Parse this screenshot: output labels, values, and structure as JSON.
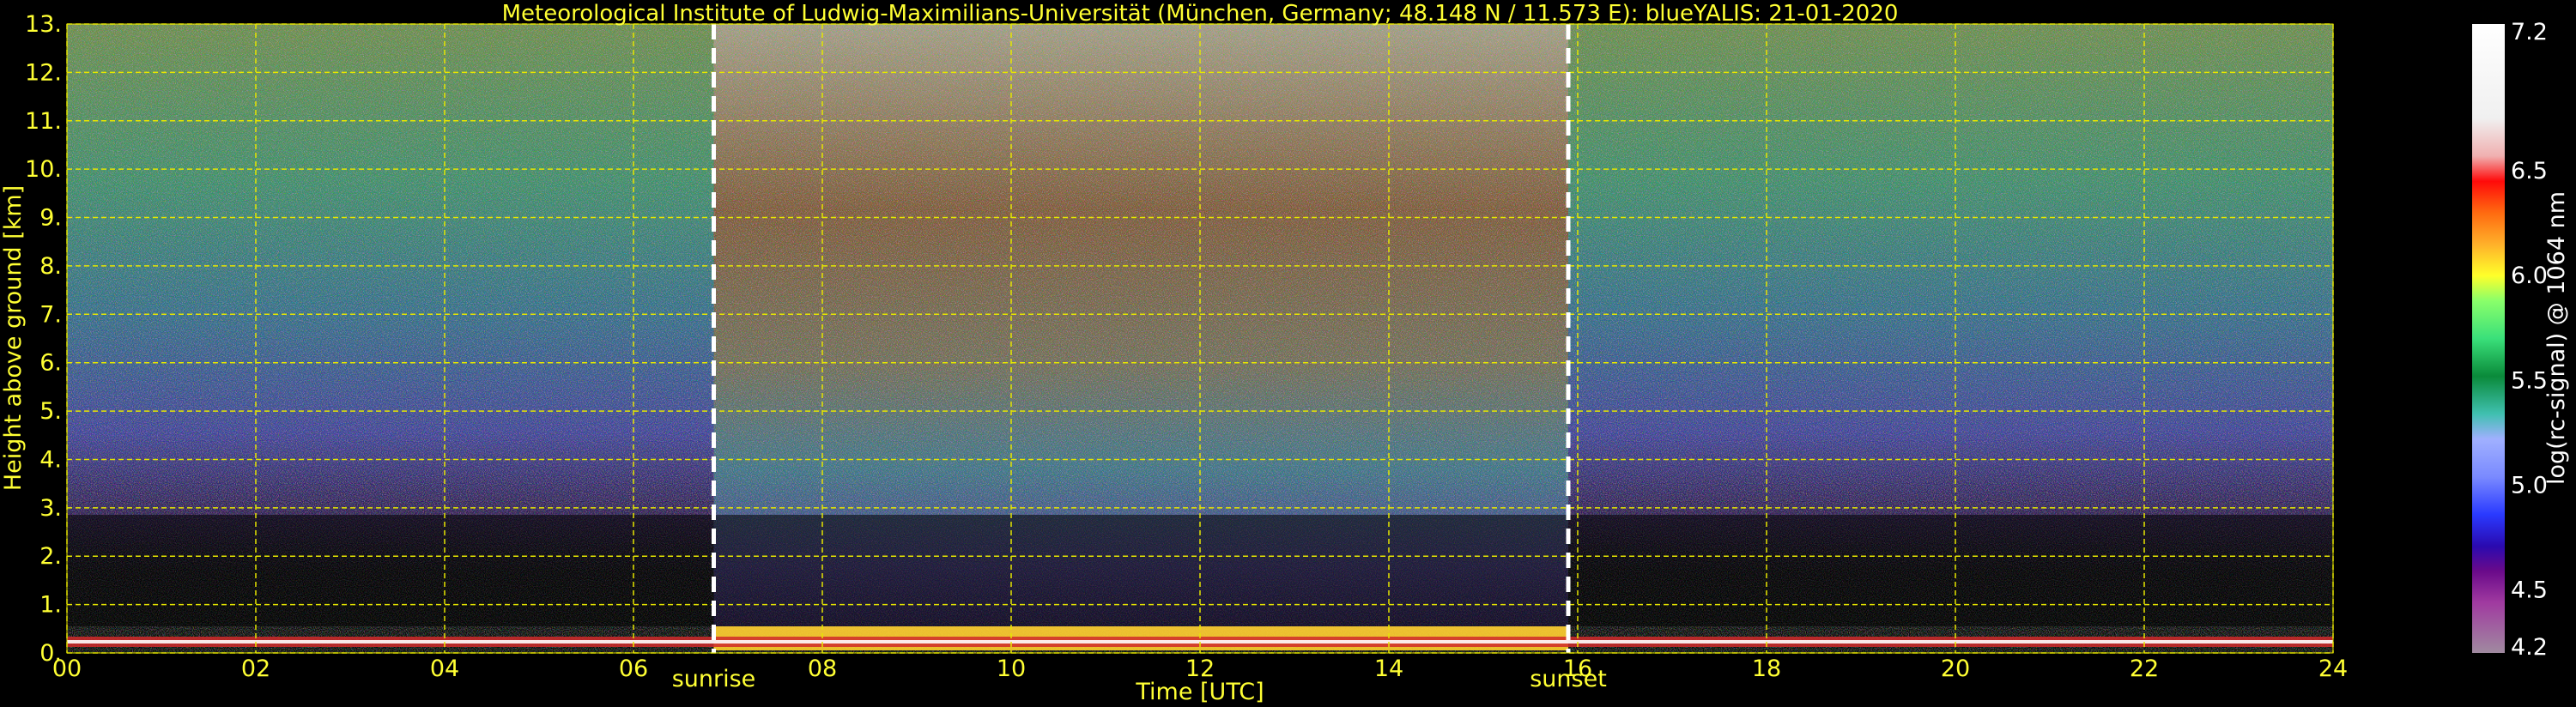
{
  "chart_data": {
    "type": "heatmap",
    "title": "Meteorological Institute of Ludwig-Maximilians-Universität (München, Germany; 48.148 N / 11.573 E):    blueYALIS: 21-01-2020",
    "xlabel": "Time [UTC]",
    "ylabel": "Height above ground [km]",
    "xlim": [
      0,
      24
    ],
    "ylim": [
      0,
      13
    ],
    "x_ticks": [
      "00",
      "02",
      "04",
      "06",
      "08",
      "10",
      "12",
      "14",
      "16",
      "18",
      "20",
      "22",
      "24"
    ],
    "y_ticks": [
      "0.",
      "1.",
      "2.",
      "3.",
      "4.",
      "5.",
      "6.",
      "7.",
      "8.",
      "9.",
      "10.",
      "11.",
      "12.",
      "13."
    ],
    "grid": true,
    "grid_color": "#e6e600",
    "annotations": [
      {
        "label": "sunrise",
        "x": 6.85
      },
      {
        "label": "sunset",
        "x": 15.9
      }
    ],
    "colorbar": {
      "label": "log(rc-signal) @ 1064 nm",
      "range": [
        4.2,
        7.2
      ],
      "ticks": [
        "7.2",
        "6.5",
        "6.0",
        "5.5",
        "5.0",
        "4.5",
        "4.2"
      ]
    },
    "colors": {
      "text": "#ffff33",
      "background": "#000000",
      "marker": "#ffffff"
    }
  }
}
